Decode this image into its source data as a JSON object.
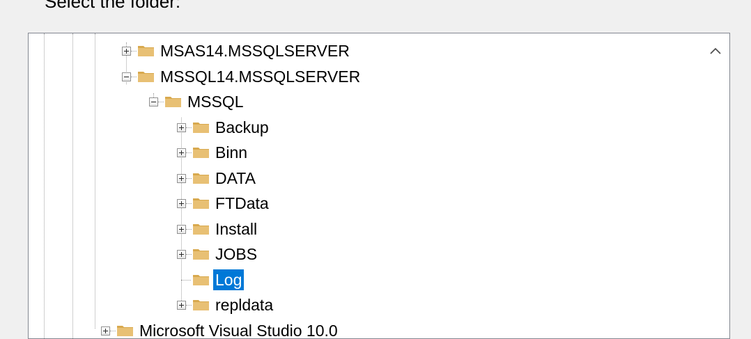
{
  "dialog": {
    "prompt": "Select the folder:"
  },
  "tree": {
    "items": [
      {
        "label": "MSAS14.MSSQLSERVER",
        "depth": 0,
        "state": "collapsed",
        "selected": false
      },
      {
        "label": "MSSQL14.MSSQLSERVER",
        "depth": 0,
        "state": "expanded",
        "selected": false
      },
      {
        "label": "MSSQL",
        "depth": 1,
        "state": "expanded",
        "selected": false
      },
      {
        "label": "Backup",
        "depth": 2,
        "state": "collapsed",
        "selected": false
      },
      {
        "label": "Binn",
        "depth": 2,
        "state": "collapsed",
        "selected": false
      },
      {
        "label": "DATA",
        "depth": 2,
        "state": "collapsed",
        "selected": false
      },
      {
        "label": "FTData",
        "depth": 2,
        "state": "collapsed",
        "selected": false
      },
      {
        "label": "Install",
        "depth": 2,
        "state": "collapsed",
        "selected": false
      },
      {
        "label": "JOBS",
        "depth": 2,
        "state": "collapsed",
        "selected": false
      },
      {
        "label": "Log",
        "depth": 2,
        "state": "leaf",
        "selected": true
      },
      {
        "label": "repldata",
        "depth": 2,
        "state": "collapsed",
        "selected": false
      },
      {
        "label": "Microsoft Visual Studio 10.0",
        "depth": -1,
        "state": "collapsed",
        "selected": false
      }
    ]
  },
  "scrollbar": {
    "up_icon": "chevron-up-icon"
  },
  "colors": {
    "selection": "#0078d7",
    "folder_fill": "#e8c074",
    "folder_tab": "#d8a94e"
  }
}
